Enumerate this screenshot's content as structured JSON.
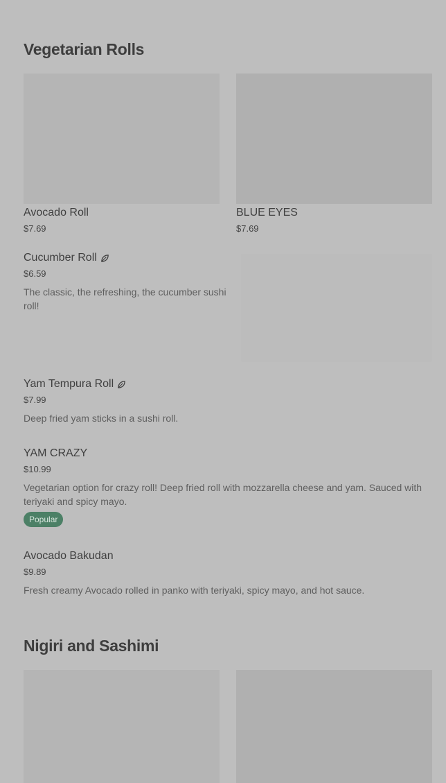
{
  "sections": {
    "vegetarian": {
      "title": "Vegetarian Rolls",
      "cards": [
        {
          "name": "Avocado Roll",
          "price": "$7.69"
        },
        {
          "name": "BLUE EYES",
          "price": "$7.69"
        }
      ],
      "items": [
        {
          "name": "Cucumber Roll",
          "price": "$6.59",
          "desc": "The classic, the refreshing, the cucumber sushi roll!"
        },
        {
          "name": "Yam Tempura Roll",
          "price": "$7.99",
          "desc": "Deep fried yam sticks in a sushi roll."
        },
        {
          "name": "YAM CRAZY",
          "price": "$10.99",
          "desc": "Vegetarian option for crazy roll! Deep fried roll with mozzarella cheese and yam. Sauced with teriyaki and spicy mayo.",
          "badge": "Popular"
        },
        {
          "name": "Avocado Bakudan",
          "price": "$9.89",
          "desc": "Fresh creamy Avocado rolled in panko with teriyaki, spicy mayo, and hot sauce."
        }
      ]
    },
    "nigiri": {
      "title": "Nigiri and Sashimi"
    }
  },
  "icons": {
    "vegetarian": "leaf-icon"
  },
  "colors": {
    "background": "#bebebe",
    "badge": "#4c8066",
    "image_placeholder": "#b5b5b5"
  }
}
